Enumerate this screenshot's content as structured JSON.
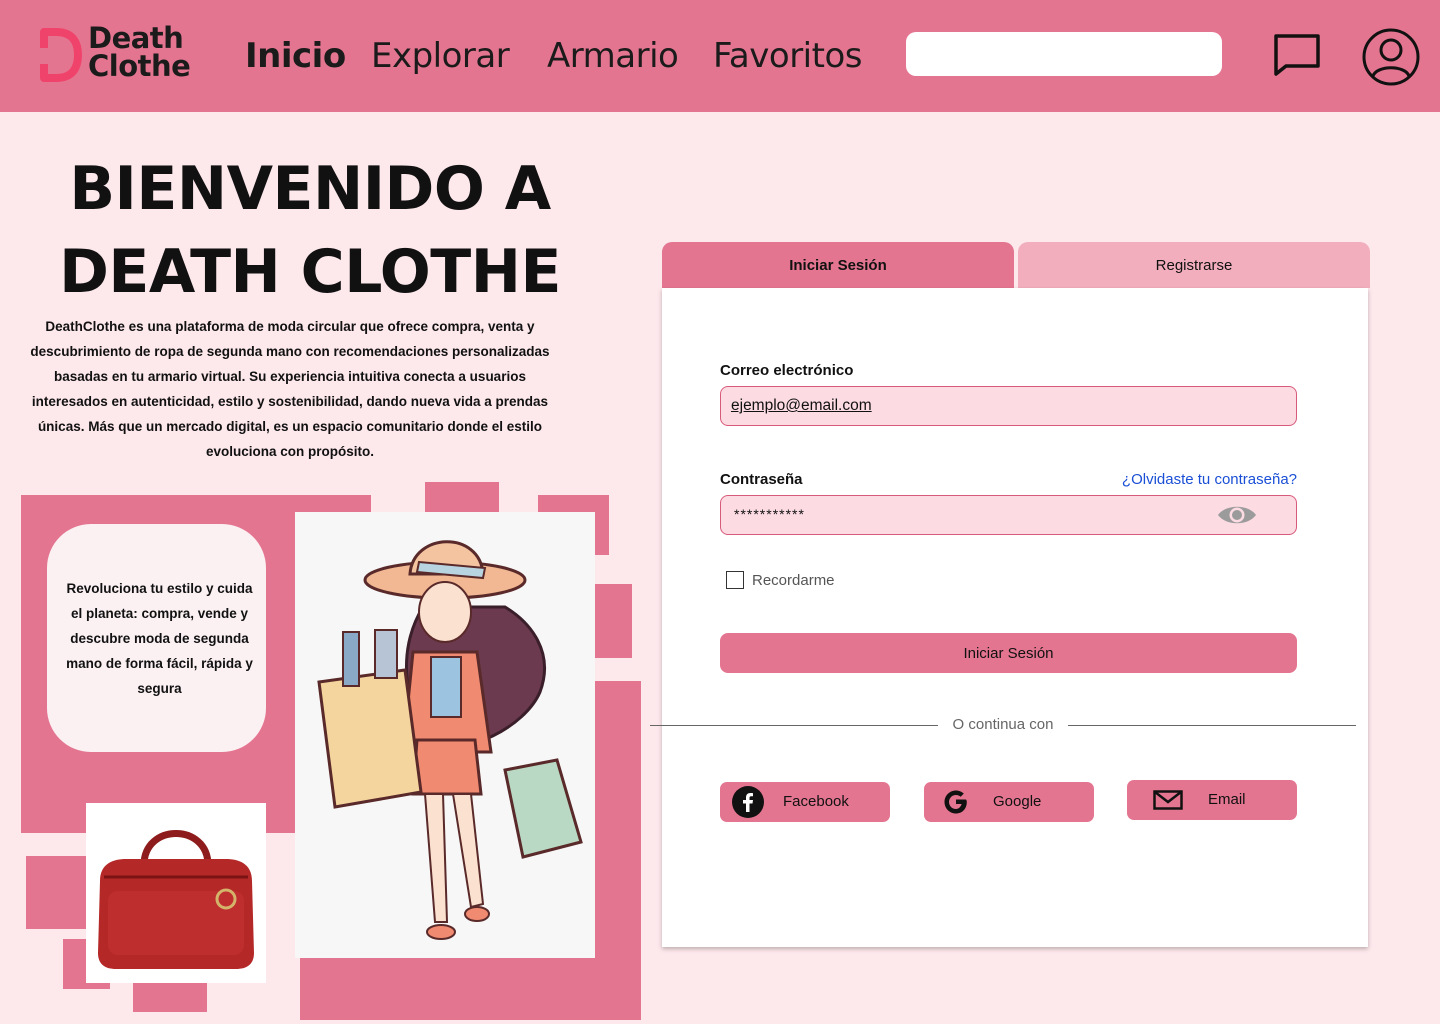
{
  "brand": {
    "line1": "Death",
    "line2": "Clothe",
    "accent": "#f0436b"
  },
  "nav": [
    {
      "label": "Inicio",
      "active": true
    },
    {
      "label": "Explorar"
    },
    {
      "label": "Armario"
    },
    {
      "label": "Favoritos"
    }
  ],
  "header": {
    "search_value": "",
    "icons": [
      "chat-icon",
      "user-account-icon"
    ],
    "bg_color": "#e47590"
  },
  "hero": {
    "title_line1": "BIENVENIDO A",
    "title_line2": "DEATH CLOTHE",
    "description": "DeathClothe es una plataforma de moda circular que ofrece compra, venta y descubrimiento de ropa de segunda mano con recomendaciones personalizadas basadas en tu armario virtual. Su experiencia intuitiva conecta a usuarios interesados en autenticidad, estilo y sostenibilidad, dando nueva vida a prendas únicas. Más que un mercado digital, es un espacio comunitario donde el estilo evoluciona con propósito.",
    "quote": "Revoluciona tu estilo y cuida el planeta: compra, vende y descubre moda de segunda mano de forma fácil, rápida y segura"
  },
  "auth": {
    "tabs": [
      {
        "label": "Iniciar Sesión",
        "active": true
      },
      {
        "label": "Registrarse"
      }
    ],
    "email_label": "Correo electrónico",
    "email_value": "ejemplo@email.com",
    "password_label": "Contraseña",
    "password_value": "***********",
    "forgot": "¿Olvidaste tu contraseña?",
    "remember": "Recordarme",
    "remember_checked": false,
    "submit": "Iniciar Sesión",
    "divider": "O continua con",
    "social": [
      {
        "label": "Facebook",
        "icon": "facebook-icon"
      },
      {
        "label": "Google",
        "icon": "google-icon"
      },
      {
        "label": "Email",
        "icon": "mail-icon"
      }
    ]
  },
  "colors": {
    "page_bg": "#fde8ec",
    "primary": "#e47590",
    "tab_inactive": "#f2aebd",
    "field_bg": "#fcdbe3",
    "link": "#1a4fd6"
  }
}
